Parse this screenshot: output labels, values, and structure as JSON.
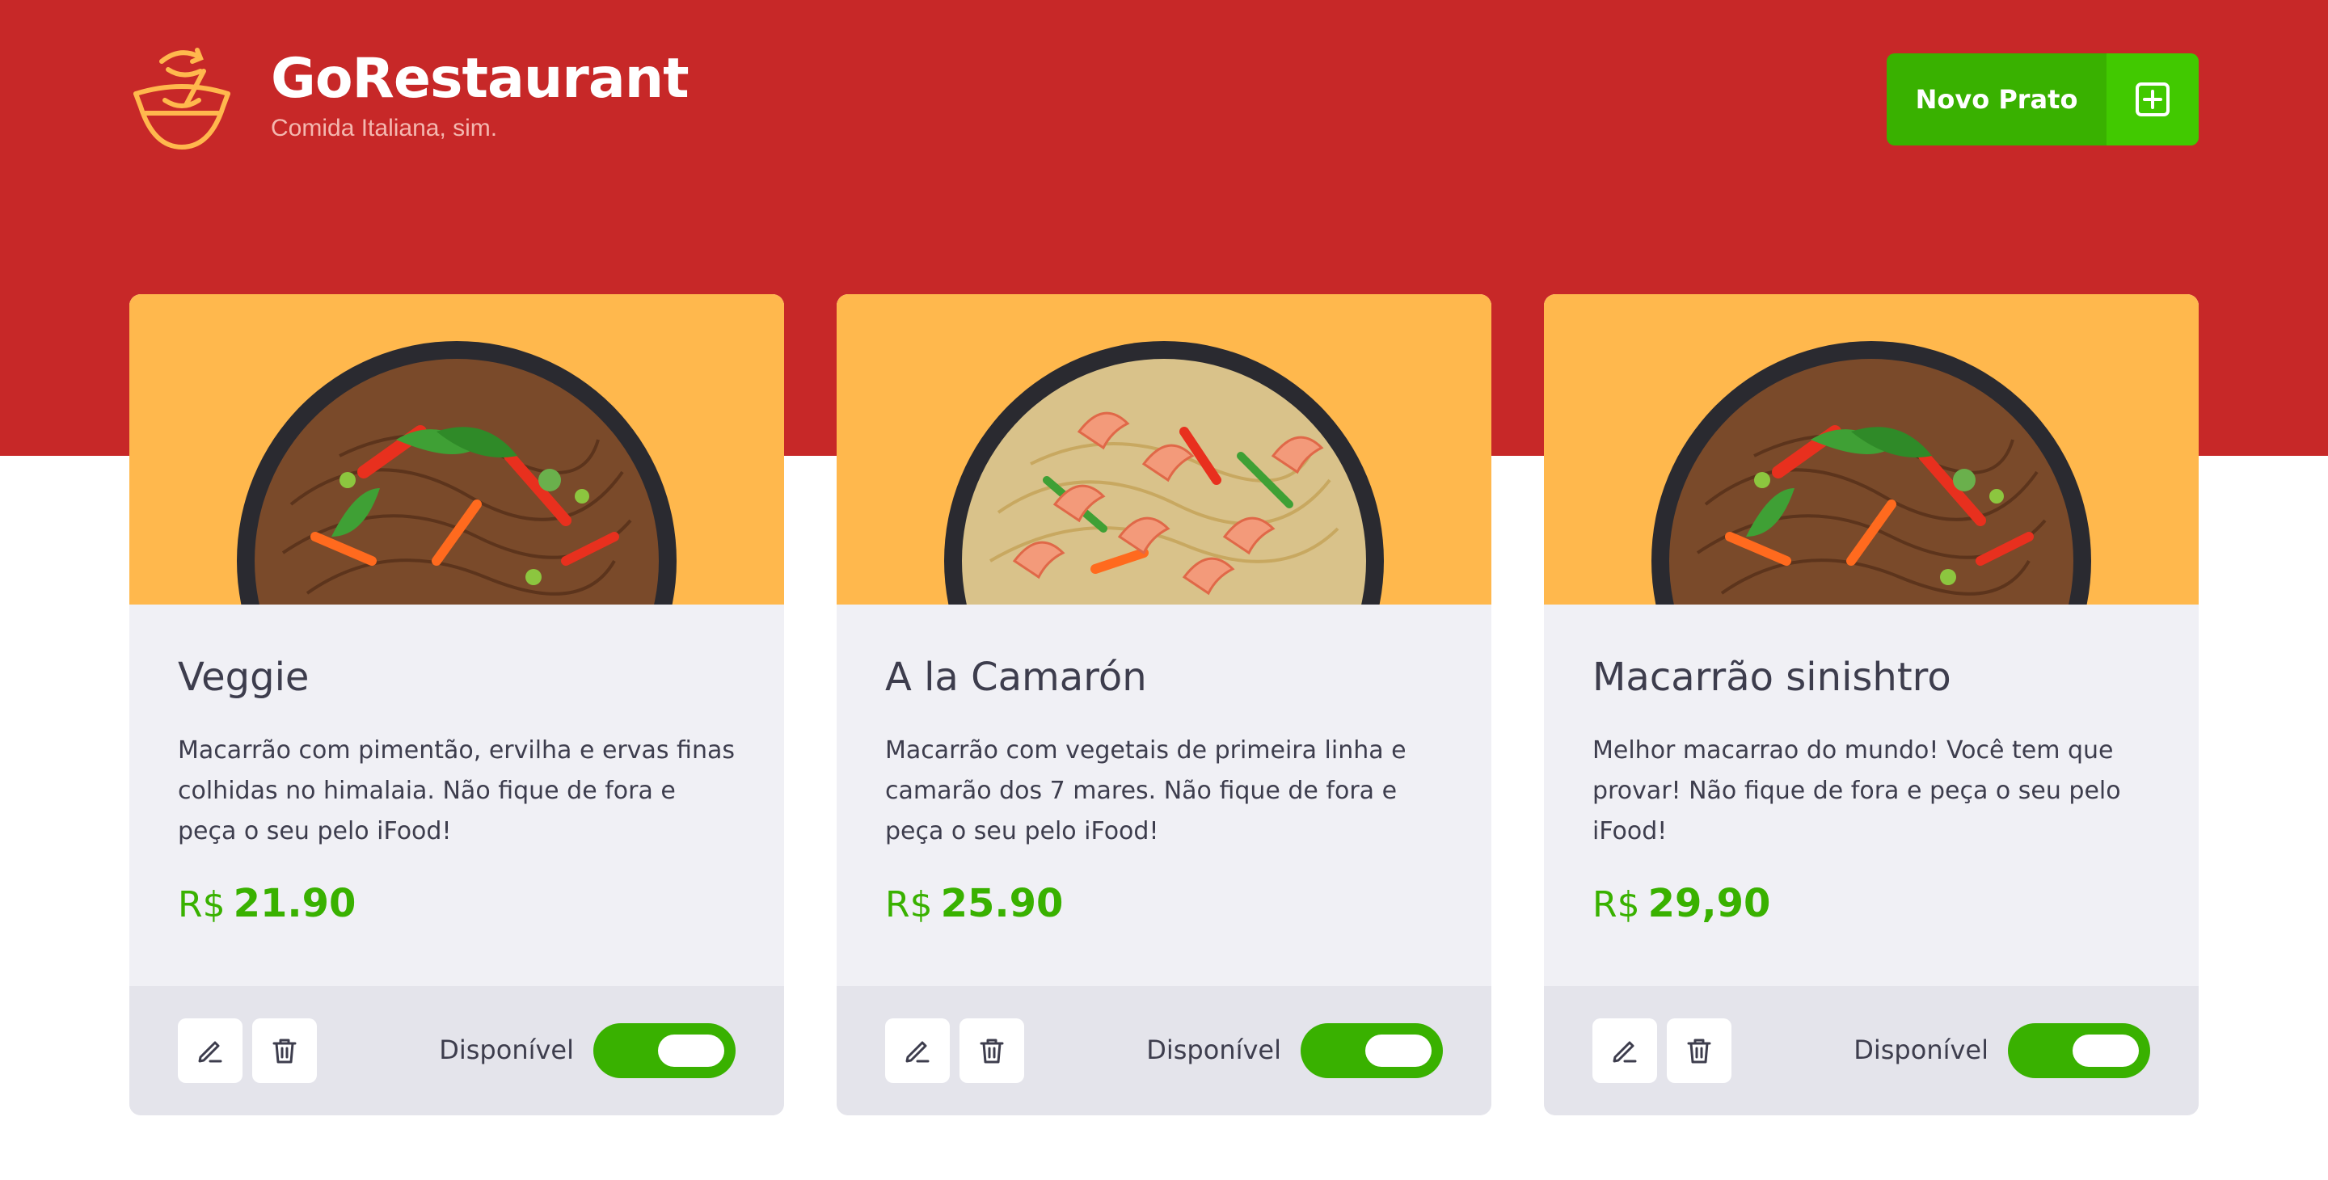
{
  "header": {
    "title": "GoRestaurant",
    "subtitle": "Comida Italiana, sim.",
    "new_button_label": "Novo Prato",
    "logo_icon": "noodle-bowl-icon",
    "add_icon": "plus-square-icon"
  },
  "colors": {
    "brand_red": "#c72828",
    "accent_green": "#39b100",
    "image_background": "#ffb84d",
    "card_background": "#f0f0f5",
    "footer_background": "#e4e4eb"
  },
  "foods": [
    {
      "name": "Veggie",
      "description": "Macarrão com pimentão, ervilha e ervas finas colhidas no himalaia. Não fique de fora e peça o seu pelo iFood!",
      "currency": "R$",
      "price": "21.90",
      "available_label": "Disponível",
      "available": true,
      "image": "veggie-noodles-photo"
    },
    {
      "name": "A la Camarón",
      "description": "Macarrão com vegetais de primeira linha e camarão dos 7 mares. Não fique de fora e peça o seu pelo iFood!",
      "currency": "R$",
      "price": "25.90",
      "available_label": "Disponível",
      "available": true,
      "image": "shrimp-noodles-photo"
    },
    {
      "name": "Macarrão sinishtro",
      "description": "Melhor macarrao do mundo! Você tem que provar! Não fique de fora e peça o seu pelo iFood!",
      "currency": "R$",
      "price": "29,90",
      "available_label": "Disponível",
      "available": true,
      "image": "veggie-noodles-photo"
    }
  ]
}
